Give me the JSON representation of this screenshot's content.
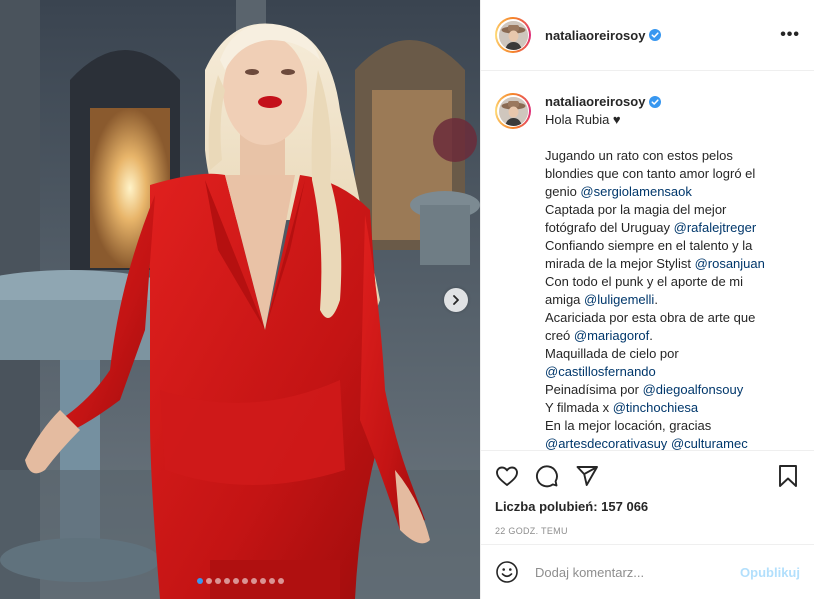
{
  "post": {
    "image_alt": "",
    "carousel": {
      "total": 10,
      "active": 1
    }
  },
  "header": {
    "username": "nataliaoreirosoy",
    "more_label": "•••"
  },
  "caption": {
    "username": "nataliaoreirosoy",
    "title": "Hola Rubia ♥",
    "lines": [
      [
        "Jugando un rato con estos pelos"
      ],
      [
        "blondies que con tanto amor logró el"
      ],
      [
        "genio ",
        "@sergiolamensaok"
      ],
      [
        "Captada por la magia del mejor"
      ],
      [
        "fotógrafo del Uruguay ",
        "@rafalejtreger"
      ],
      [
        "Confiando siempre en el talento y la"
      ],
      [
        "mirada de la mejor Stylist ",
        "@rosanjuan"
      ],
      [
        "Con todo el punk y el aporte de mi"
      ],
      [
        "amiga ",
        "@luligemelli",
        "."
      ],
      [
        "Acariciada por esta obra de arte que"
      ],
      [
        "creó ",
        "@mariagorof",
        "."
      ],
      [
        "Maquillada de cielo por"
      ],
      [
        "@castillosfernando"
      ],
      [
        "Peinadísima por ",
        "@diegoalfonsouy"
      ],
      [
        "Y filmada x ",
        "@tinchochiesa"
      ],
      [
        "En la mejor locación, gracias"
      ],
      [
        "@artesdecorativasuy",
        " ",
        "@culturamec"
      ]
    ]
  },
  "actions": {
    "likes_text": "Liczba polubień: 157 066",
    "time_text": "22 godz. temu"
  },
  "comment_box": {
    "placeholder": "Dodaj komentarz...",
    "publish_label": "Opublikuj"
  },
  "colors": {
    "accent": "#3897f0",
    "mention": "#00376b",
    "publish_disabled": "#b2dffc",
    "muted": "#8e8e8e"
  }
}
